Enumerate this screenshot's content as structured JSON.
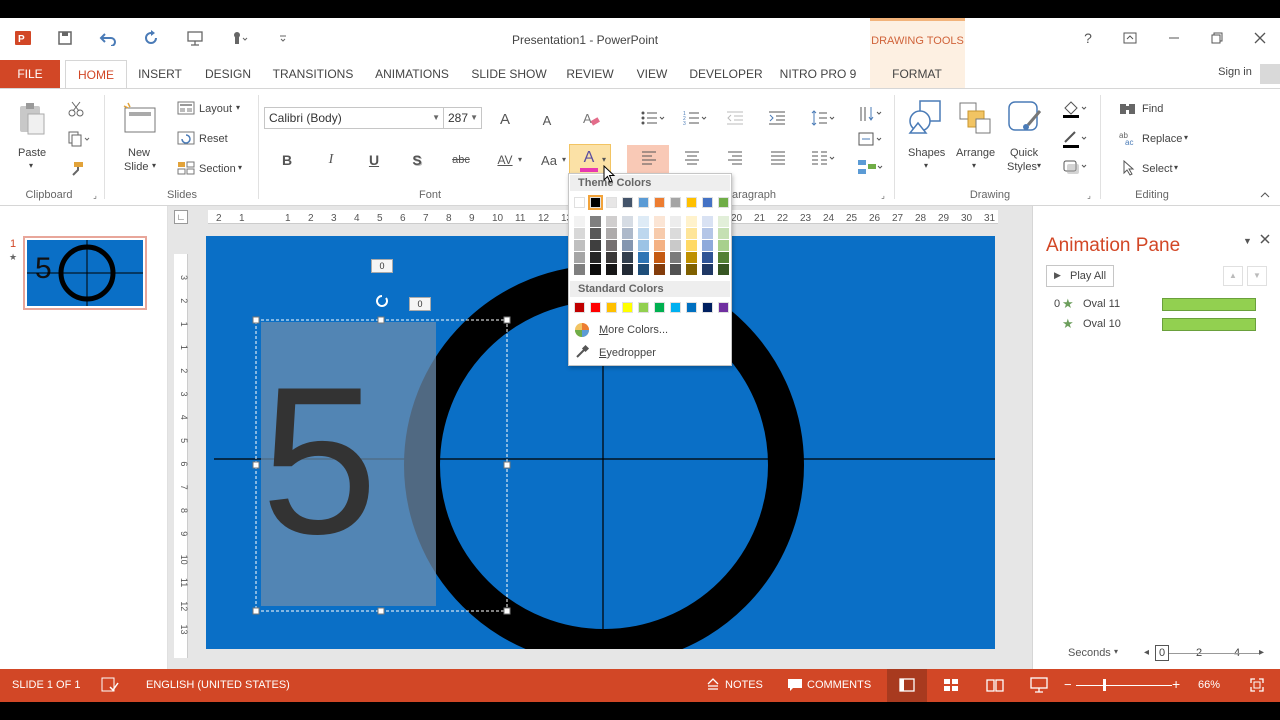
{
  "window": {
    "title": "Presentation1 - PowerPoint",
    "contextual_group": "DRAWING TOOLS",
    "help": "?",
    "sign_in": "Sign in"
  },
  "tabs": [
    "FILE",
    "HOME",
    "INSERT",
    "DESIGN",
    "TRANSITIONS",
    "ANIMATIONS",
    "SLIDE SHOW",
    "REVIEW",
    "VIEW",
    "DEVELOPER",
    "NITRO PRO 9",
    "FORMAT"
  ],
  "ribbon": {
    "clipboard": {
      "label": "Clipboard",
      "paste": "Paste"
    },
    "slides": {
      "label": "Slides",
      "new_slide_1": "New",
      "new_slide_2": "Slide",
      "layout": "Layout",
      "reset": "Reset",
      "section": "Section"
    },
    "font": {
      "label": "Font",
      "font_name": "Calibri (Body)",
      "font_size": "287",
      "bold": "B",
      "italic": "I",
      "underline": "U",
      "shadow": "S",
      "strike": "abc",
      "spacing": "AV",
      "case": "Aa",
      "grow": "A",
      "shrink": "A",
      "color": "A"
    },
    "paragraph": {
      "label": "aragraph"
    },
    "drawing": {
      "label": "Drawing",
      "shapes": "Shapes",
      "arrange": "Arrange",
      "quick_1": "Quick",
      "quick_2": "Styles"
    },
    "editing": {
      "label": "Editing",
      "find": "Find",
      "replace": "Replace",
      "select": "Select"
    }
  },
  "color_menu": {
    "theme_header": "Theme Colors",
    "standard_header": "Standard Colors",
    "more_colors_pre": "",
    "more_colors_u": "M",
    "more_colors_post": "ore Colors...",
    "eyedropper_pre": "",
    "eyedropper_u": "E",
    "eyedropper_post": "yedropper",
    "theme_top": [
      "#ffffff",
      "#000000",
      "#e7e6e6",
      "#44546a",
      "#5b9bd5",
      "#ed7d31",
      "#a5a5a5",
      "#ffc000",
      "#4472c4",
      "#70ad47"
    ],
    "theme_shades": [
      [
        "#f2f2f2",
        "#7f7f7f",
        "#d0cece",
        "#d6dce4",
        "#deebf6",
        "#fbe5d5",
        "#ededed",
        "#fff2cc",
        "#d9e2f3",
        "#e2efd9"
      ],
      [
        "#d8d8d8",
        "#595959",
        "#aeabab",
        "#adb9ca",
        "#bdd7ee",
        "#f7cbac",
        "#dbdbdb",
        "#fee599",
        "#b4c6e7",
        "#c5e0b3"
      ],
      [
        "#bfbfbf",
        "#3f3f3f",
        "#757070",
        "#8496b0",
        "#9cc3e5",
        "#f4b183",
        "#c9c9c9",
        "#ffd965",
        "#8eaadb",
        "#a8d08d"
      ],
      [
        "#a5a5a5",
        "#262626",
        "#3a3838",
        "#323f4f",
        "#2e75b5",
        "#c55a11",
        "#7b7b7b",
        "#bf9000",
        "#2f5496",
        "#538135"
      ],
      [
        "#7f7f7f",
        "#0c0c0c",
        "#171616",
        "#222a35",
        "#1e4e79",
        "#833c0b",
        "#525252",
        "#7f6000",
        "#1f3864",
        "#375623"
      ]
    ],
    "standard": [
      "#c00000",
      "#ff0000",
      "#ffc000",
      "#ffff00",
      "#92d050",
      "#00b050",
      "#00b0f0",
      "#0070c0",
      "#002060",
      "#7030a0"
    ]
  },
  "thumbnail": {
    "number": "1",
    "star": "★",
    "digit": "5"
  },
  "slide": {
    "big_digit": "5",
    "badge_top": "0",
    "badge_right": "0"
  },
  "ruler": {
    "h_ticks": [
      "2",
      "1",
      "1",
      "2",
      "3",
      "4",
      "5",
      "6",
      "7",
      "8",
      "9",
      "10",
      "11",
      "12",
      "13",
      "30",
      "25",
      "26",
      "27",
      "28",
      "29",
      "30",
      "31"
    ],
    "h_right_ticks": [
      "20",
      "21",
      "22",
      "23",
      "24",
      "25",
      "26",
      "27",
      "28",
      "29",
      "30",
      "31"
    ],
    "v_ticks": [
      "3",
      "2",
      "1",
      "1",
      "2",
      "3",
      "4",
      "5",
      "6",
      "7",
      "8",
      "9",
      "10",
      "11",
      "12",
      "13"
    ]
  },
  "animation_pane": {
    "title": "Animation Pane",
    "play_all": "Play All",
    "items": [
      {
        "index": "0",
        "name": "Oval 11"
      },
      {
        "index": "",
        "name": "Oval 10"
      }
    ],
    "seconds": "Seconds",
    "timeline": [
      "0",
      "2",
      "4"
    ]
  },
  "status": {
    "slide_of": "SLIDE 1 OF 1",
    "language": "ENGLISH (UNITED STATES)",
    "notes": "NOTES",
    "comments": "COMMENTS",
    "zoom": "66%"
  },
  "colors": {
    "accent": "#d24726",
    "slide_bg": "#0a6fc6",
    "anim_bar": "#92d050"
  }
}
